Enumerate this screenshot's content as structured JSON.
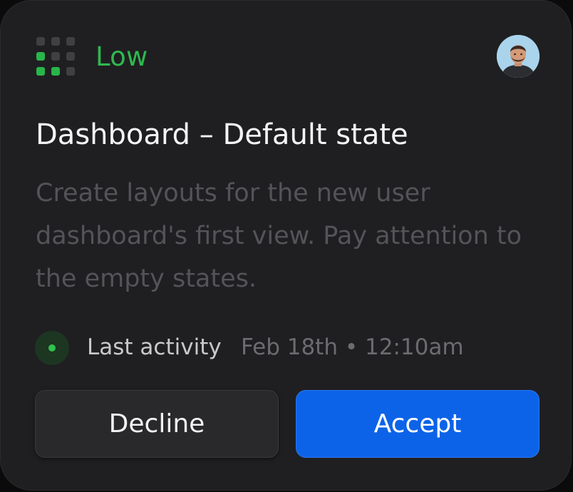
{
  "card": {
    "priority": {
      "label": "Low",
      "level_filled": 3,
      "accent_color": "#2fb84f",
      "icon": "priority-bars-icon"
    },
    "avatar": {
      "icon": "user-avatar"
    },
    "title": "Dashboard – Default state",
    "description": "Create layouts for the new user dashboard's first view. Pay attention to the empty states.",
    "activity": {
      "label": "Last activity",
      "timestamp": "Feb 18th • 12:10am",
      "status_color": "#2fc24f"
    },
    "actions": {
      "decline_label": "Decline",
      "accept_label": "Accept",
      "accept_color": "#0d63e8"
    }
  }
}
